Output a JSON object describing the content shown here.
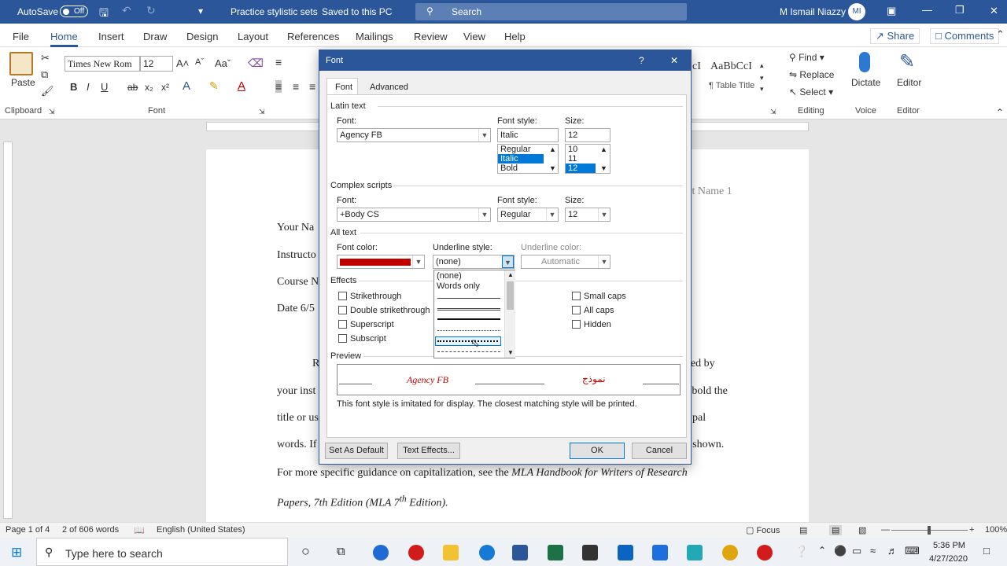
{
  "titlebar": {
    "autosave": "AutoSave",
    "toggle": "Off",
    "doc_title": "Practice stylistic sets",
    "saved": "Saved to this PC",
    "search": "Search",
    "user": "M Ismail Niazzy",
    "initials": "MI"
  },
  "tabs": [
    "File",
    "Home",
    "Insert",
    "Draw",
    "Design",
    "Layout",
    "References",
    "Mailings",
    "Review",
    "View",
    "Help"
  ],
  "share": "Share",
  "comments": "Comments",
  "ribbon": {
    "paste": "Paste",
    "font_name": "Times New Rom",
    "font_size": "12",
    "groups": {
      "clipboard": "Clipboard",
      "font": "Font",
      "editing": "Editing",
      "voice": "Voice",
      "editor": "Editor"
    },
    "style1": "AaBbCcI",
    "style2": "¶ Table Title",
    "style_cut": "cI",
    "find": "Find",
    "replace": "Replace",
    "select": "Select",
    "dictate": "Dictate",
    "editor_btn": "Editor",
    "bold": "B",
    "italic": "I",
    "underline": "U",
    "strike": "ab",
    "sub": "x₂",
    "sup": "x²"
  },
  "document": {
    "header_right": "st Name 1",
    "lines": [
      "Your Na",
      "Instructo",
      "Course N",
      "Date 6/5"
    ],
    "para_start": "R",
    "right1": "ted by",
    "row2l": "your inst",
    "row2r": "t bold the",
    "row3l": "title or us",
    "row3r": "pal",
    "row4l": "words. If",
    "row4r": "as shown.",
    "row5": "For more specific guidance on capitalization, see the",
    "row5i": "MLA Handbook for Writers of Research",
    "row6": "Papers, 7th Edition (MLA 7",
    "row6sup": "th",
    "row6b": "Edition)."
  },
  "statusbar": {
    "page": "Page 1 of 4",
    "words": "2 of 606 words",
    "language": "English (United States)",
    "focus": "Focus",
    "zoom": "100%"
  },
  "taskbar": {
    "search": "Type here to search",
    "time": "5:36 PM",
    "date": "4/27/2020"
  },
  "dialog": {
    "title": "Font",
    "help": "?",
    "close": "✕",
    "tabs": [
      "Font",
      "Advanced"
    ],
    "latin": {
      "section": "Latin text",
      "font_label": "Font:",
      "font": "Agency FB",
      "style_label": "Font style:",
      "style": "Italic",
      "size_label": "Size:",
      "size": "12",
      "style_list": [
        "Regular",
        "Italic",
        "Bold"
      ],
      "size_list": [
        "10",
        "11",
        "12"
      ]
    },
    "complex": {
      "section": "Complex scripts",
      "font_label": "Font:",
      "font": "+Body CS",
      "style_label": "Font style:",
      "style": "Regular",
      "size_label": "Size:",
      "size": "12"
    },
    "alltext": {
      "section": "All text",
      "color_label": "Font color:",
      "color": "#c00000",
      "underline_label": "Underline style:",
      "underline": "(none)",
      "ucolor_label": "Underline color:",
      "ucolor": "Automatic",
      "underline_options": [
        "(none)",
        "Words only"
      ]
    },
    "effects": {
      "section": "Effects",
      "left": [
        "Strikethrough",
        "Double strikethrough",
        "Superscript",
        "Subscript"
      ],
      "right": [
        "Small caps",
        "All caps",
        "Hidden"
      ]
    },
    "preview": {
      "section": "Preview",
      "sample": "Agency FB",
      "arabic": "نموذج",
      "note": "This font style is imitated for display. The closest matching style will be printed."
    },
    "buttons": {
      "default": "Set As Default",
      "effects": "Text Effects...",
      "ok": "OK",
      "cancel": "Cancel"
    }
  }
}
